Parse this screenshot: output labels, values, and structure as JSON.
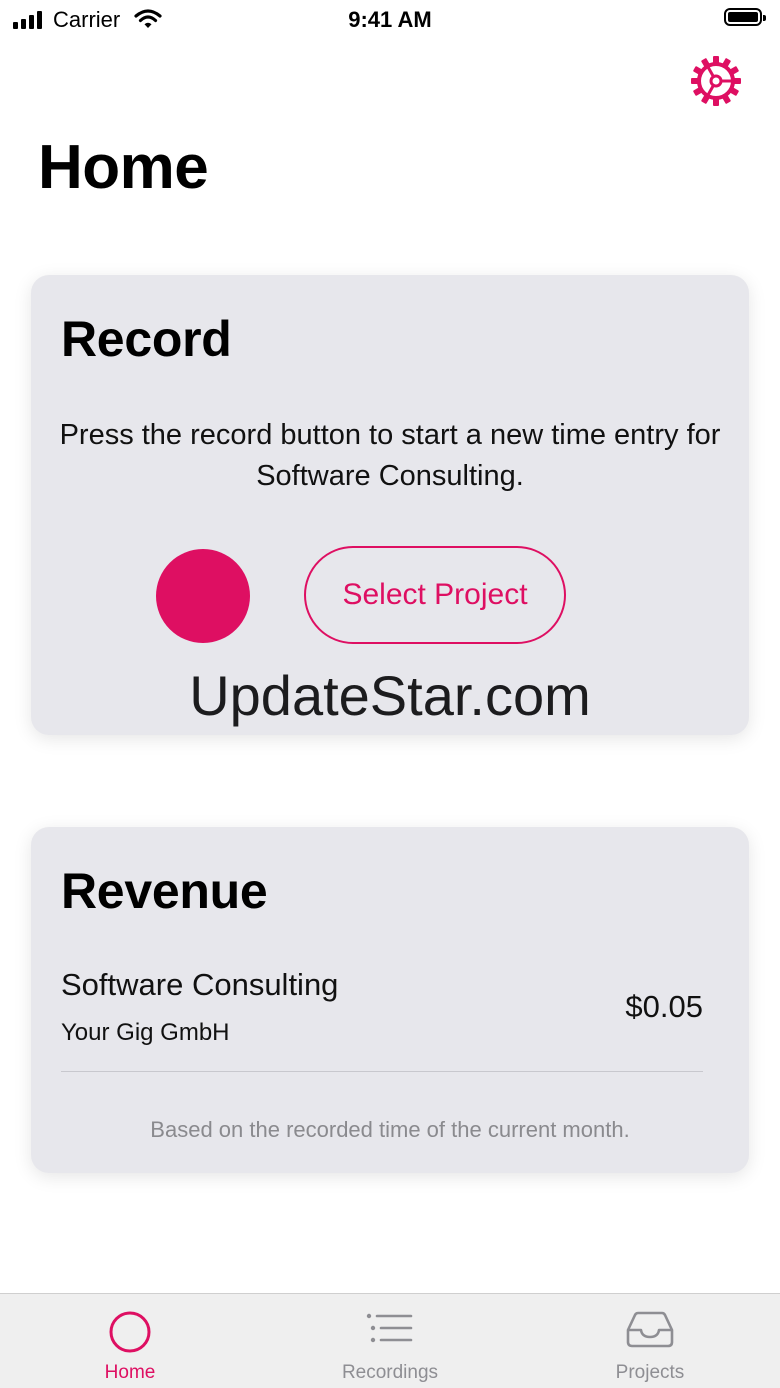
{
  "status_bar": {
    "carrier": "Carrier",
    "time": "9:41 AM"
  },
  "header": {
    "title": "Home",
    "settings_icon": "gear-icon"
  },
  "record_card": {
    "title": "Record",
    "description": "Press the record button to start a new time entry for Software Consulting.",
    "select_project_label": "Select Project",
    "watermark": "UpdateStar.com"
  },
  "revenue_card": {
    "title": "Revenue",
    "project_name": "Software Consulting",
    "client_name": "Your Gig GmbH",
    "amount": "$0.05",
    "footnote": "Based on the recorded time of the current month."
  },
  "tab_bar": {
    "tabs": [
      {
        "label": "Home",
        "icon": "circle-icon",
        "selected": true
      },
      {
        "label": "Recordings",
        "icon": "list-icon",
        "selected": false
      },
      {
        "label": "Projects",
        "icon": "tray-icon",
        "selected": false
      }
    ]
  },
  "colors": {
    "accent": "#de0f62",
    "card_background": "#e7e7ec",
    "inactive_tab": "#8e8e93"
  }
}
